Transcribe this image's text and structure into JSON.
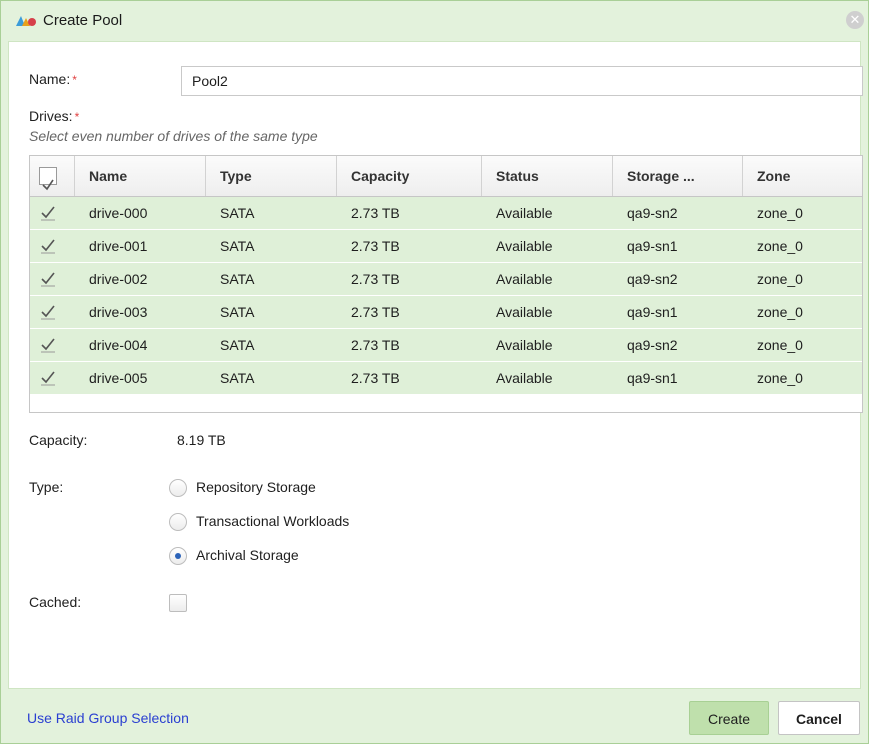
{
  "dialog": {
    "title": "Create Pool",
    "close_icon": "close-icon"
  },
  "form": {
    "name_label": "Name:",
    "name_value": "Pool2",
    "required_mark": "*",
    "drives_label": "Drives:",
    "drives_hint": "Select even number of drives of the same type",
    "capacity_label": "Capacity:",
    "capacity_value": "8.19 TB",
    "type_label": "Type:",
    "type_options": [
      "Repository Storage",
      "Transactional Workloads",
      "Archival Storage"
    ],
    "type_selected": "Archival Storage",
    "cached_label": "Cached:",
    "cached_checked": false
  },
  "grid": {
    "columns": [
      "Name",
      "Type",
      "Capacity",
      "Status",
      "Storage ...",
      "Zone"
    ],
    "rows": [
      {
        "checked": true,
        "name": "drive-000",
        "type": "SATA",
        "capacity": "2.73 TB",
        "status": "Available",
        "storage": "qa9-sn2",
        "zone": "zone_0"
      },
      {
        "checked": true,
        "name": "drive-001",
        "type": "SATA",
        "capacity": "2.73 TB",
        "status": "Available",
        "storage": "qa9-sn1",
        "zone": "zone_0"
      },
      {
        "checked": true,
        "name": "drive-002",
        "type": "SATA",
        "capacity": "2.73 TB",
        "status": "Available",
        "storage": "qa9-sn2",
        "zone": "zone_0"
      },
      {
        "checked": true,
        "name": "drive-003",
        "type": "SATA",
        "capacity": "2.73 TB",
        "status": "Available",
        "storage": "qa9-sn1",
        "zone": "zone_0"
      },
      {
        "checked": true,
        "name": "drive-004",
        "type": "SATA",
        "capacity": "2.73 TB",
        "status": "Available",
        "storage": "qa9-sn2",
        "zone": "zone_0"
      },
      {
        "checked": true,
        "name": "drive-005",
        "type": "SATA",
        "capacity": "2.73 TB",
        "status": "Available",
        "storage": "qa9-sn1",
        "zone": "zone_0"
      }
    ]
  },
  "footer": {
    "raid_link": "Use Raid Group Selection",
    "create_label": "Create",
    "cancel_label": "Cancel"
  },
  "colors": {
    "selected_row": "#dff0d8",
    "dialog_frame": "#e3f2dc",
    "create_button": "#bfe0ac",
    "link": "#2a3fd1",
    "required": "#e04040"
  }
}
